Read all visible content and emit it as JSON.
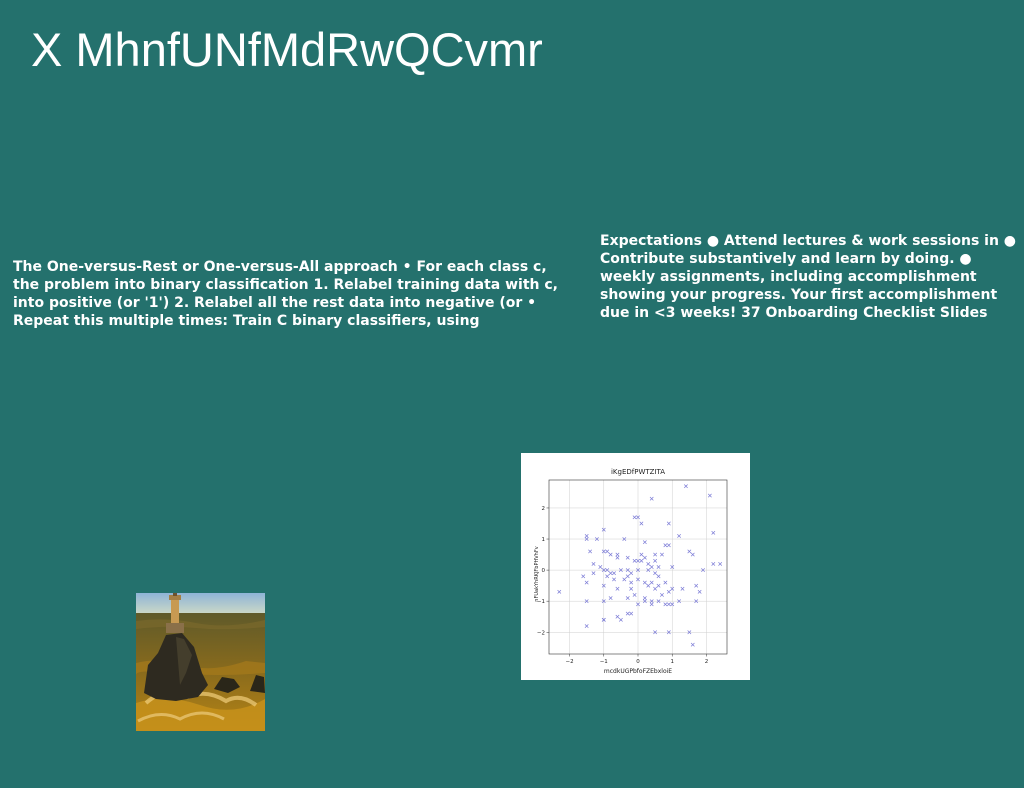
{
  "slide": {
    "background_color": "#24716d",
    "text_color": "#ffffff",
    "title": "X MhnfUNfMdRwQCvmr",
    "left_text": "The One-versus-Rest or One-versus-All approach • For each class c, the problem into binary classification 1. Relabel training data with c, into positive (or '1') 2. Relabel all the rest data into negative (or • Repeat this multiple times: Train C binary classifiers, using",
    "right_text": "Expectations ● Attend lectures & work sessions in ● Contribute substantively and learn by doing. ● weekly assignments, including accomplishment showing your progress. Your first accomplishment due in <3 weeks! 37 Onboarding Checklist Slides",
    "photo": {
      "subject": "lighthouse-on-rocks-photo"
    }
  },
  "chart_data": {
    "type": "scatter",
    "title": "iKgEDfPWTZITA",
    "xlabel": "mcdkUGPbfoFZEbxloiE",
    "ylabel": "nFUakYhRKJFbPHVhFv",
    "xlim": [
      -2.6,
      2.6
    ],
    "ylim": [
      -2.7,
      2.9
    ],
    "xticks": [
      -2,
      -1,
      0,
      1,
      2
    ],
    "yticks": [
      -2,
      -1,
      0,
      1,
      2
    ],
    "tick_labels_x": [
      "−2",
      "−1",
      "0",
      "1",
      "2"
    ],
    "tick_labels_y": [
      "−2",
      "−1",
      "0",
      "1",
      "2"
    ],
    "marker": "x",
    "color": "#7b7bd6",
    "grid": true,
    "x": [
      1.4,
      2.1,
      0.4,
      -0.1,
      0.0,
      0.1,
      0.9,
      -1.0,
      1.2,
      2.2,
      -1.5,
      -1.5,
      -1.2,
      -0.4,
      0.2,
      0.8,
      0.9,
      -1.4,
      -0.9,
      -1.0,
      -0.8,
      -0.6,
      0.1,
      0.2,
      0.5,
      0.7,
      1.5,
      1.6,
      2.4,
      2.2,
      -0.6,
      -0.3,
      -0.1,
      0.0,
      0.1,
      0.3,
      0.4,
      0.5,
      0.6,
      -1.3,
      -1.1,
      -1.0,
      -0.9,
      -0.8,
      -0.7,
      -0.5,
      -0.3,
      -0.2,
      0.0,
      0.3,
      0.5,
      1.0,
      1.9,
      -1.6,
      -1.3,
      -0.9,
      -0.7,
      -0.4,
      -0.3,
      -0.2,
      0.0,
      0.2,
      0.4,
      0.6,
      0.8,
      1.0,
      1.7,
      1.8,
      -1.5,
      -1.0,
      -0.6,
      -0.2,
      0.3,
      0.5,
      0.7,
      0.9,
      1.3,
      -1.5,
      -0.8,
      -0.3,
      -0.1,
      0.2,
      0.4,
      0.6,
      0.8,
      1.0,
      1.7,
      -2.3,
      -1.0,
      -1.0,
      -0.5,
      -0.3,
      0.0,
      0.2,
      0.4,
      0.5,
      0.9,
      1.2,
      -1.5,
      -1.0,
      -0.6,
      -0.2,
      0.6,
      0.9,
      1.5,
      1.6
    ],
    "y": [
      2.7,
      2.4,
      2.3,
      1.7,
      1.7,
      1.5,
      1.5,
      1.3,
      1.1,
      1.2,
      1.1,
      1.0,
      1.0,
      1.0,
      0.9,
      0.8,
      0.8,
      0.6,
      0.6,
      0.6,
      0.5,
      0.5,
      0.5,
      0.4,
      0.5,
      0.5,
      0.6,
      0.5,
      0.2,
      0.2,
      0.4,
      0.4,
      0.3,
      0.3,
      0.3,
      0.2,
      0.1,
      0.3,
      0.1,
      0.2,
      0.1,
      0.0,
      0.0,
      -0.1,
      -0.1,
      0.0,
      0.0,
      -0.1,
      0.0,
      0.0,
      -0.1,
      0.1,
      0.0,
      -0.2,
      -0.1,
      -0.2,
      -0.3,
      -0.3,
      -0.2,
      -0.4,
      -0.3,
      -0.4,
      -0.4,
      -0.5,
      -0.4,
      -0.6,
      -0.5,
      -0.7,
      -0.4,
      -0.5,
      -0.6,
      -0.6,
      -0.5,
      -0.6,
      -0.8,
      -0.7,
      -0.6,
      -1.0,
      -0.9,
      -0.9,
      -0.8,
      -0.9,
      -1.0,
      -1.0,
      -1.1,
      -1.1,
      -1.0,
      -0.7,
      -1.6,
      -1.0,
      -1.6,
      -1.4,
      -1.1,
      -1.0,
      -1.1,
      -2.0,
      -1.1,
      -1.0,
      -1.8,
      -1.6,
      -1.5,
      -1.4,
      -0.2,
      -2.0,
      -2.0,
      -2.4
    ]
  }
}
